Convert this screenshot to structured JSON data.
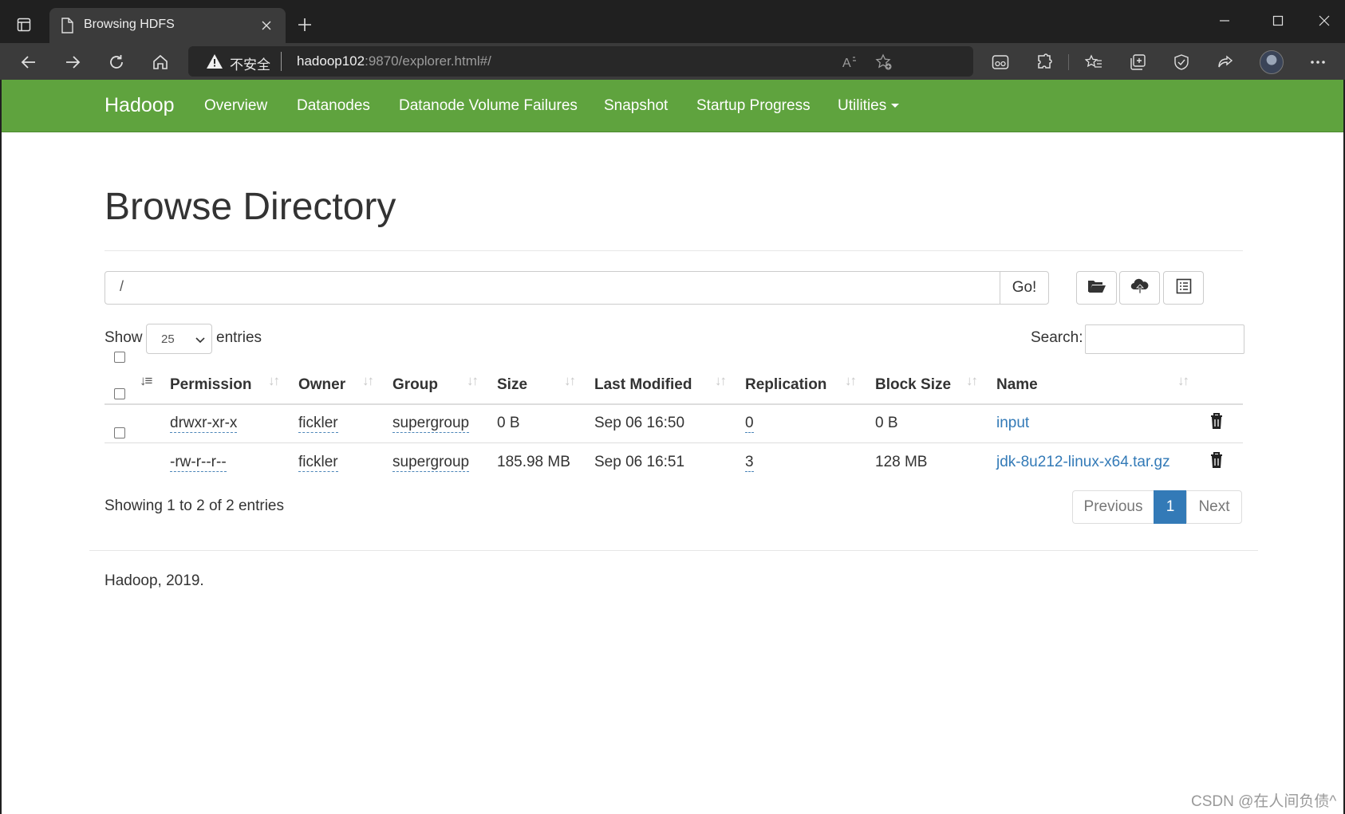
{
  "browser": {
    "tab_title": "Browsing HDFS",
    "security_label": "不安全",
    "url_host": "hadoop102",
    "url_rest": ":9870/explorer.html#/"
  },
  "nav": {
    "brand": "Hadoop",
    "links": [
      "Overview",
      "Datanodes",
      "Datanode Volume Failures",
      "Snapshot",
      "Startup Progress",
      "Utilities"
    ]
  },
  "page": {
    "title": "Browse Directory",
    "path_value": "/",
    "go_label": "Go!",
    "show_label": "Show",
    "entries_value": "25",
    "entries_label": "entries",
    "search_label": "Search:"
  },
  "table": {
    "columns": [
      "Permission",
      "Owner",
      "Group",
      "Size",
      "Last Modified",
      "Replication",
      "Block Size",
      "Name"
    ],
    "rows": [
      {
        "permission": "drwxr-xr-x",
        "owner": "fickler",
        "group": "supergroup",
        "size": "0 B",
        "modified": "Sep 06 16:50",
        "replication": "0",
        "block_size": "0 B",
        "name": "input"
      },
      {
        "permission": "-rw-r--r--",
        "owner": "fickler",
        "group": "supergroup",
        "size": "185.98 MB",
        "modified": "Sep 06 16:51",
        "replication": "3",
        "block_size": "128 MB",
        "name": "jdk-8u212-linux-x64.tar.gz"
      }
    ]
  },
  "pagination": {
    "info": "Showing 1 to 2 of 2 entries",
    "previous": "Previous",
    "current": "1",
    "next": "Next"
  },
  "footer": "Hadoop, 2019.",
  "watermark": "CSDN @在人间负债^",
  "colors": {
    "navbar": "#5fa33e",
    "link": "#337ab7",
    "active_page": "#337ab7"
  }
}
